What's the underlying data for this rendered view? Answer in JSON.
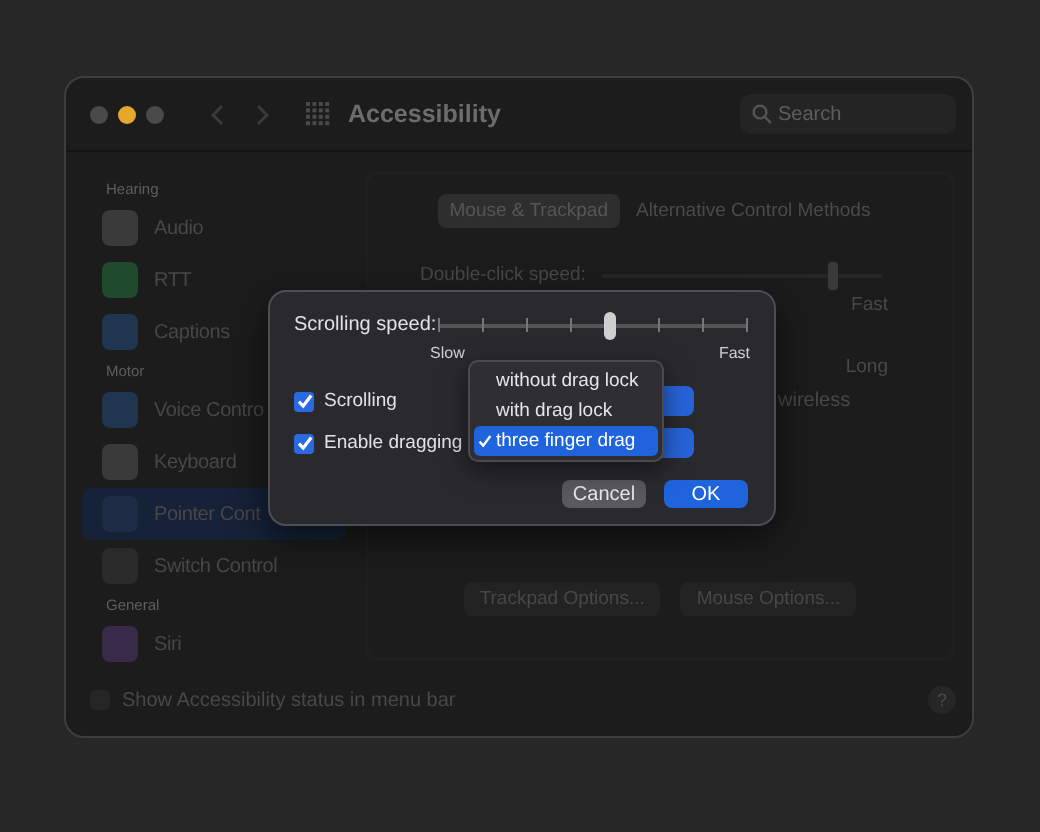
{
  "window": {
    "title": "Accessibility",
    "search": {
      "placeholder": "Search"
    }
  },
  "sidebar": {
    "sections": [
      {
        "header": "Hearing",
        "items": [
          {
            "label": "Audio",
            "selected": false
          },
          {
            "label": "RTT",
            "selected": false
          },
          {
            "label": "Captions",
            "selected": false
          }
        ]
      },
      {
        "header": "Motor",
        "items": [
          {
            "label": "Voice Contro",
            "selected": false
          },
          {
            "label": "Keyboard",
            "selected": false
          },
          {
            "label": "Pointer Cont",
            "selected": true
          },
          {
            "label": "Switch Control",
            "selected": false
          }
        ]
      },
      {
        "header": "General",
        "items": [
          {
            "label": "Siri",
            "selected": false
          }
        ]
      }
    ]
  },
  "pane": {
    "tabs": [
      {
        "label": "Mouse & Trackpad",
        "selected": true
      },
      {
        "label": "Alternative Control Methods",
        "selected": false
      }
    ],
    "double_click": {
      "label": "Double-click speed:",
      "level": 0.82,
      "max_label": "Fast"
    },
    "delay_max_label": "Long",
    "partial_text": "wireless",
    "buttons": [
      "Trackpad Options...",
      "Mouse Options..."
    ]
  },
  "status_checkbox": {
    "label": "Show Accessibility status in menu bar",
    "checked": false
  },
  "help": "?",
  "sheet": {
    "speed": {
      "label": "Scrolling speed:",
      "level": 0.56,
      "min_label": "Slow",
      "max_label": "Fast"
    },
    "options": [
      {
        "label": "Scrolling",
        "checked": true
      },
      {
        "label": "Enable dragging",
        "checked": true
      }
    ],
    "menu": [
      {
        "label": "without drag lock",
        "selected": false
      },
      {
        "label": "with drag lock",
        "selected": false
      },
      {
        "label": "three finger drag",
        "selected": true
      }
    ],
    "buttons": [
      {
        "label": "Cancel",
        "kind": "secondary"
      },
      {
        "label": "OK",
        "kind": "primary"
      }
    ]
  }
}
